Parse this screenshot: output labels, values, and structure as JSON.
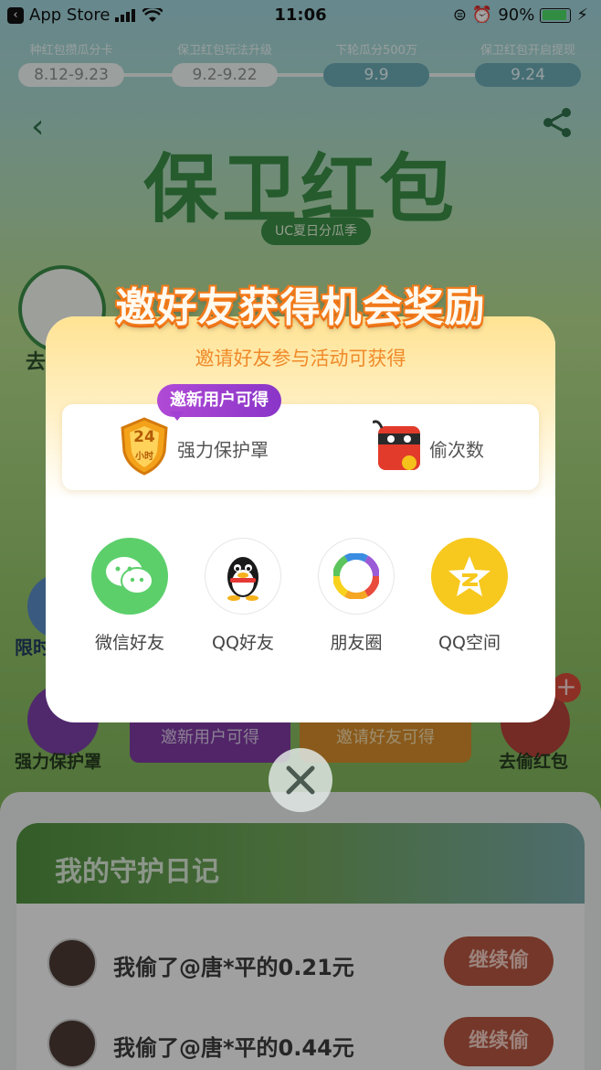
{
  "status_bar": {
    "carrier": "App Store",
    "time": "11:06",
    "battery": "90%",
    "battery_fraction": 0.9
  },
  "timeline": [
    {
      "label": "种红包攒瓜分卡",
      "date": "8.12-9.23",
      "active": false
    },
    {
      "label": "保卫红包玩法升级",
      "date": "9.2-9.22",
      "active": false
    },
    {
      "label": "下轮瓜分500万",
      "date": "9.9",
      "active": true
    },
    {
      "label": "保卫红包开启提现",
      "date": "9.24",
      "active": true
    }
  ],
  "hero": {
    "title": "保卫红包",
    "subtitle": "UC夏日分瓜季"
  },
  "background": {
    "left_go": "去",
    "left_limit": "限时",
    "left_shield_label": "强力保护罩",
    "purple_btn": "邀新用户可得",
    "orange_btn": "邀请好友可得",
    "right_steal": "去偷红包"
  },
  "modal": {
    "title": "邀好友获得机会奖励",
    "subtitle": "邀请好友参与活动可获得",
    "tag": "邀新用户可得",
    "shield_number": "24",
    "shield_small": "小时",
    "reward1": "强力保护罩",
    "reward2": "偷次数",
    "share": [
      {
        "label": "微信好友",
        "icon": "wechat-icon",
        "color": "#5ccf6b"
      },
      {
        "label": "QQ好友",
        "icon": "qq-penguin-icon",
        "color": "#ffffff"
      },
      {
        "label": "朋友圈",
        "icon": "moments-aperture-icon",
        "color": "#ffffff"
      },
      {
        "label": "QQ空间",
        "icon": "qzone-star-icon",
        "color": "#f7c81e"
      }
    ]
  },
  "diary": {
    "title": "我的守护日记",
    "rows": [
      {
        "text": "我偷了@唐*平的0.21元",
        "button": "继续偷"
      },
      {
        "text": "我偷了@唐*平的0.44元",
        "button": "继续偷"
      }
    ]
  },
  "colors": {
    "accent_orange": "#f08a2a",
    "tag_purple": "#a140d2",
    "brand_green": "#3a8c45"
  }
}
